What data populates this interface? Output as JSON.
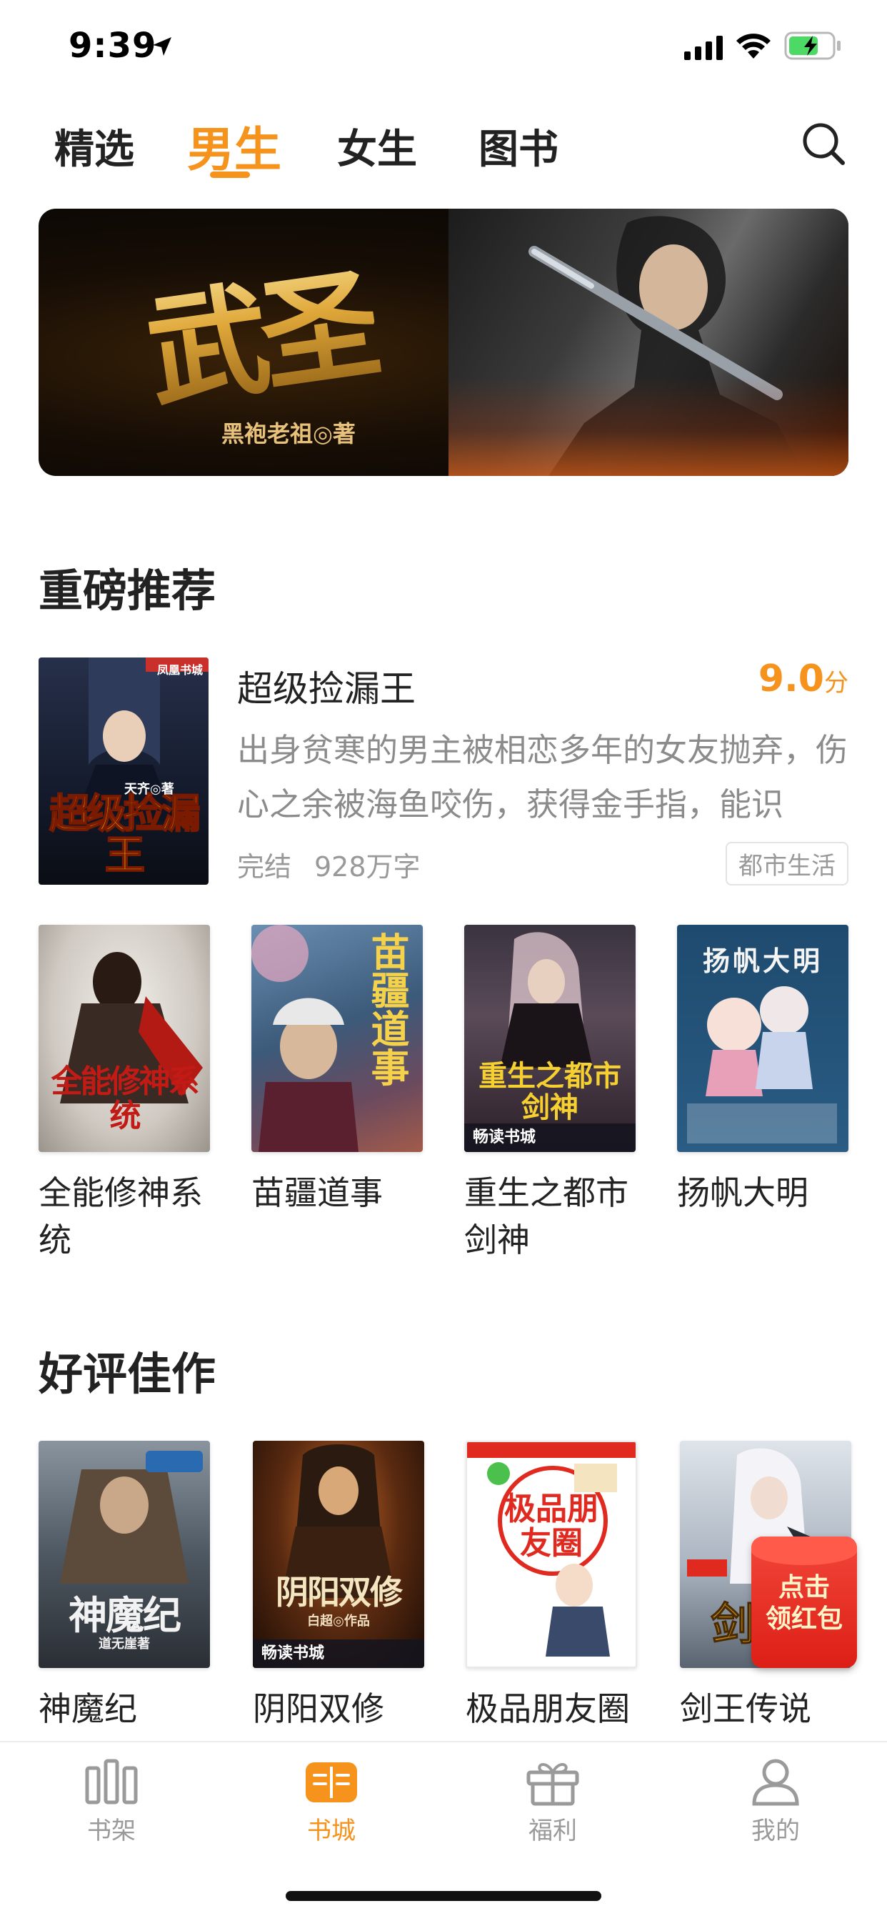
{
  "status_bar": {
    "time": "9:39"
  },
  "top_tabs": [
    {
      "label": "精选",
      "active": false
    },
    {
      "label": "男生",
      "active": true
    },
    {
      "label": "女生",
      "active": false
    },
    {
      "label": "图书",
      "active": false
    }
  ],
  "banner": {
    "title": "武圣",
    "author": "黑袍老祖◎著"
  },
  "section_recommended": {
    "title": "重磅推荐",
    "featured": {
      "name": "超级捡漏王",
      "score": "9.0",
      "score_unit": "分",
      "description": "出身贫寒的男主被相恋多年的女友抛弃，伤心之余被海鱼咬伤，获得金手指，能识",
      "status": "完结",
      "word_count": "928万字",
      "tag": "都市生活",
      "cover_text": "超级捡漏王",
      "cover_author": "天齐◎著",
      "cover_publisher": "凤凰书城"
    },
    "books": [
      {
        "title": "全能修神系统",
        "cover_text": "全能修神系统"
      },
      {
        "title": "苗疆道事",
        "cover_text": "苗疆道事"
      },
      {
        "title": "重生之都市剑神",
        "cover_text": "重生之都市剑神",
        "cover_badge": "畅读书城"
      },
      {
        "title": "扬帆大明",
        "cover_text": "扬帆大明"
      }
    ]
  },
  "section_acclaimed": {
    "title": "好评佳作",
    "books": [
      {
        "title": "神魔纪",
        "cover_text": "神魔纪",
        "cover_author": "道无崖著"
      },
      {
        "title": "阴阳双修",
        "cover_text": "阴阳双修",
        "cover_author": "白超◎作品",
        "cover_badge": "畅读书城"
      },
      {
        "title": "极品朋友圈",
        "cover_text": "极品朋友圈"
      },
      {
        "title": "剑王传说",
        "cover_text": "剑王"
      }
    ]
  },
  "red_packet": {
    "label": "点击\n领红包"
  },
  "bottom_nav": [
    {
      "label": "书架",
      "icon": "bookshelf-icon",
      "active": false
    },
    {
      "label": "书城",
      "icon": "bookstore-icon",
      "active": true
    },
    {
      "label": "福利",
      "icon": "gift-icon",
      "active": false
    },
    {
      "label": "我的",
      "icon": "profile-icon",
      "active": false
    }
  ],
  "colors": {
    "accent": "#f5931d",
    "text": "#222222",
    "muted": "#999999",
    "red_packet": "#e02a20"
  }
}
